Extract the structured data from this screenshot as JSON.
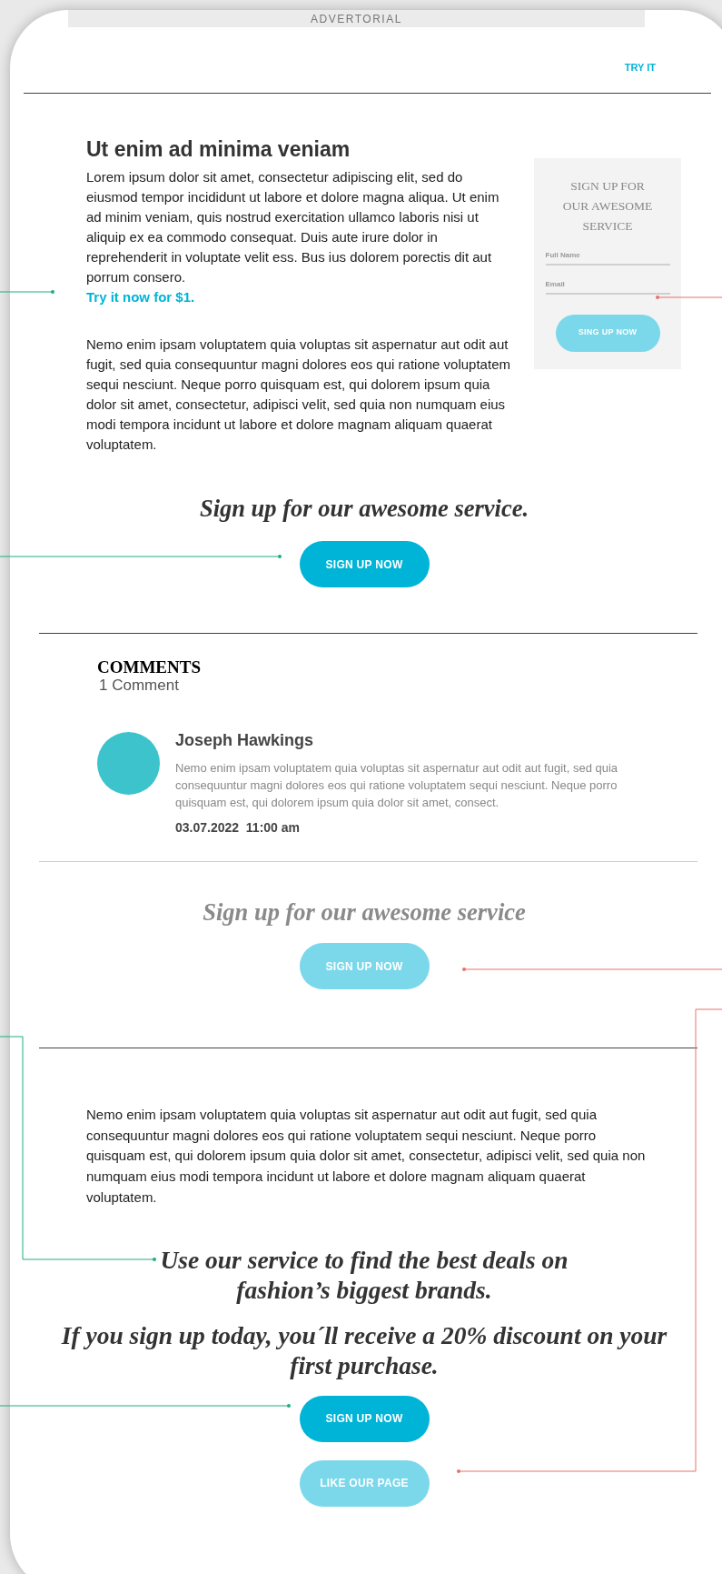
{
  "ad_banner": {
    "label": "ADVERTORIAL"
  },
  "header": {
    "link": "TRY IT"
  },
  "article": {
    "title": "Ut enim ad minima veniam",
    "paragraphs": [
      {
        "text": "Lorem ipsum dolor sit amet, consectetur adipiscing elit, sed do eiusmod tempor incididunt ut labore et dolore magna aliqua. Ut enim ad minim veniam, quis nostrud exercitation ullamco laboris nisi ut aliquip ex ea commodo consequat. Duis aute irure dolor in reprehenderit in voluptate velit ess. Bus ius dolorem porectis dit aut porrum consero.",
        "link": "Try it now for $1."
      },
      {
        "text": "Nemo enim ipsam voluptatem quia voluptas sit aspernatur aut odit aut fugit, sed quia consequuntur magni dolores eos qui ratione voluptatem sequi nesciunt. Neque porro quisquam est, qui dolorem ipsum quia dolor sit amet, consectetur, adipisci velit, sed quia non numquam eius modi tempora incidunt ut labore et dolore magnam aliquam quaerat voluptatem."
      }
    ]
  },
  "signup_box": {
    "title": "SIGN UP FOR OUR AWESOME SERVICE",
    "fields": [
      {
        "placeholder": "Full Name"
      },
      {
        "placeholder": "Email"
      }
    ],
    "button": {
      "label": "SING UP NOW",
      "kind": "light"
    }
  },
  "cta_1": {
    "headline": "Sign up for our awesome service.",
    "muted": false,
    "button": {
      "label": "SIGN UP NOW",
      "kind": "solid"
    }
  },
  "comments": {
    "title": "COMMENTS",
    "count": "1 Comment",
    "items": [
      {
        "author": "Joseph Hawkings",
        "text": "Nemo enim ipsam voluptatem quia voluptas sit aspernatur aut odit aut fugit, sed quia consequuntur magni dolores eos qui ratione voluptatem sequi nesciunt. Neque porro quisquam est, qui dolorem ipsum quia dolor sit amet, consect.",
        "date": "03.07.2022  11:00 am"
      }
    ]
  },
  "cta_2": {
    "headline": "Sign up for our awesome service",
    "muted": true,
    "button": {
      "label": "SIGN UP NOW",
      "kind": "light"
    }
  },
  "closing": {
    "paragraph": "Nemo enim ipsam voluptatem quia voluptas sit aspernatur aut odit aut fugit, sed quia consequuntur magni dolores eos qui ratione voluptatem sequi nesciunt. Neque porro quisquam est, qui dolorem ipsum quia dolor sit amet, consectetur, adipisci velit, sed quia non numquam eius modi tempora incidunt ut labore et dolore magnam aliquam quaerat voluptatem.",
    "headlines": [
      "Use our service to find the best deals on fashion’s biggest brands.",
      "If you sign up today, you´ll receive a 20% discount on your first purchase."
    ],
    "buttons": [
      {
        "label": "SIGN UP NOW",
        "kind": "solid"
      },
      {
        "label": "LIKE OUR PAGE",
        "kind": "light"
      }
    ]
  }
}
